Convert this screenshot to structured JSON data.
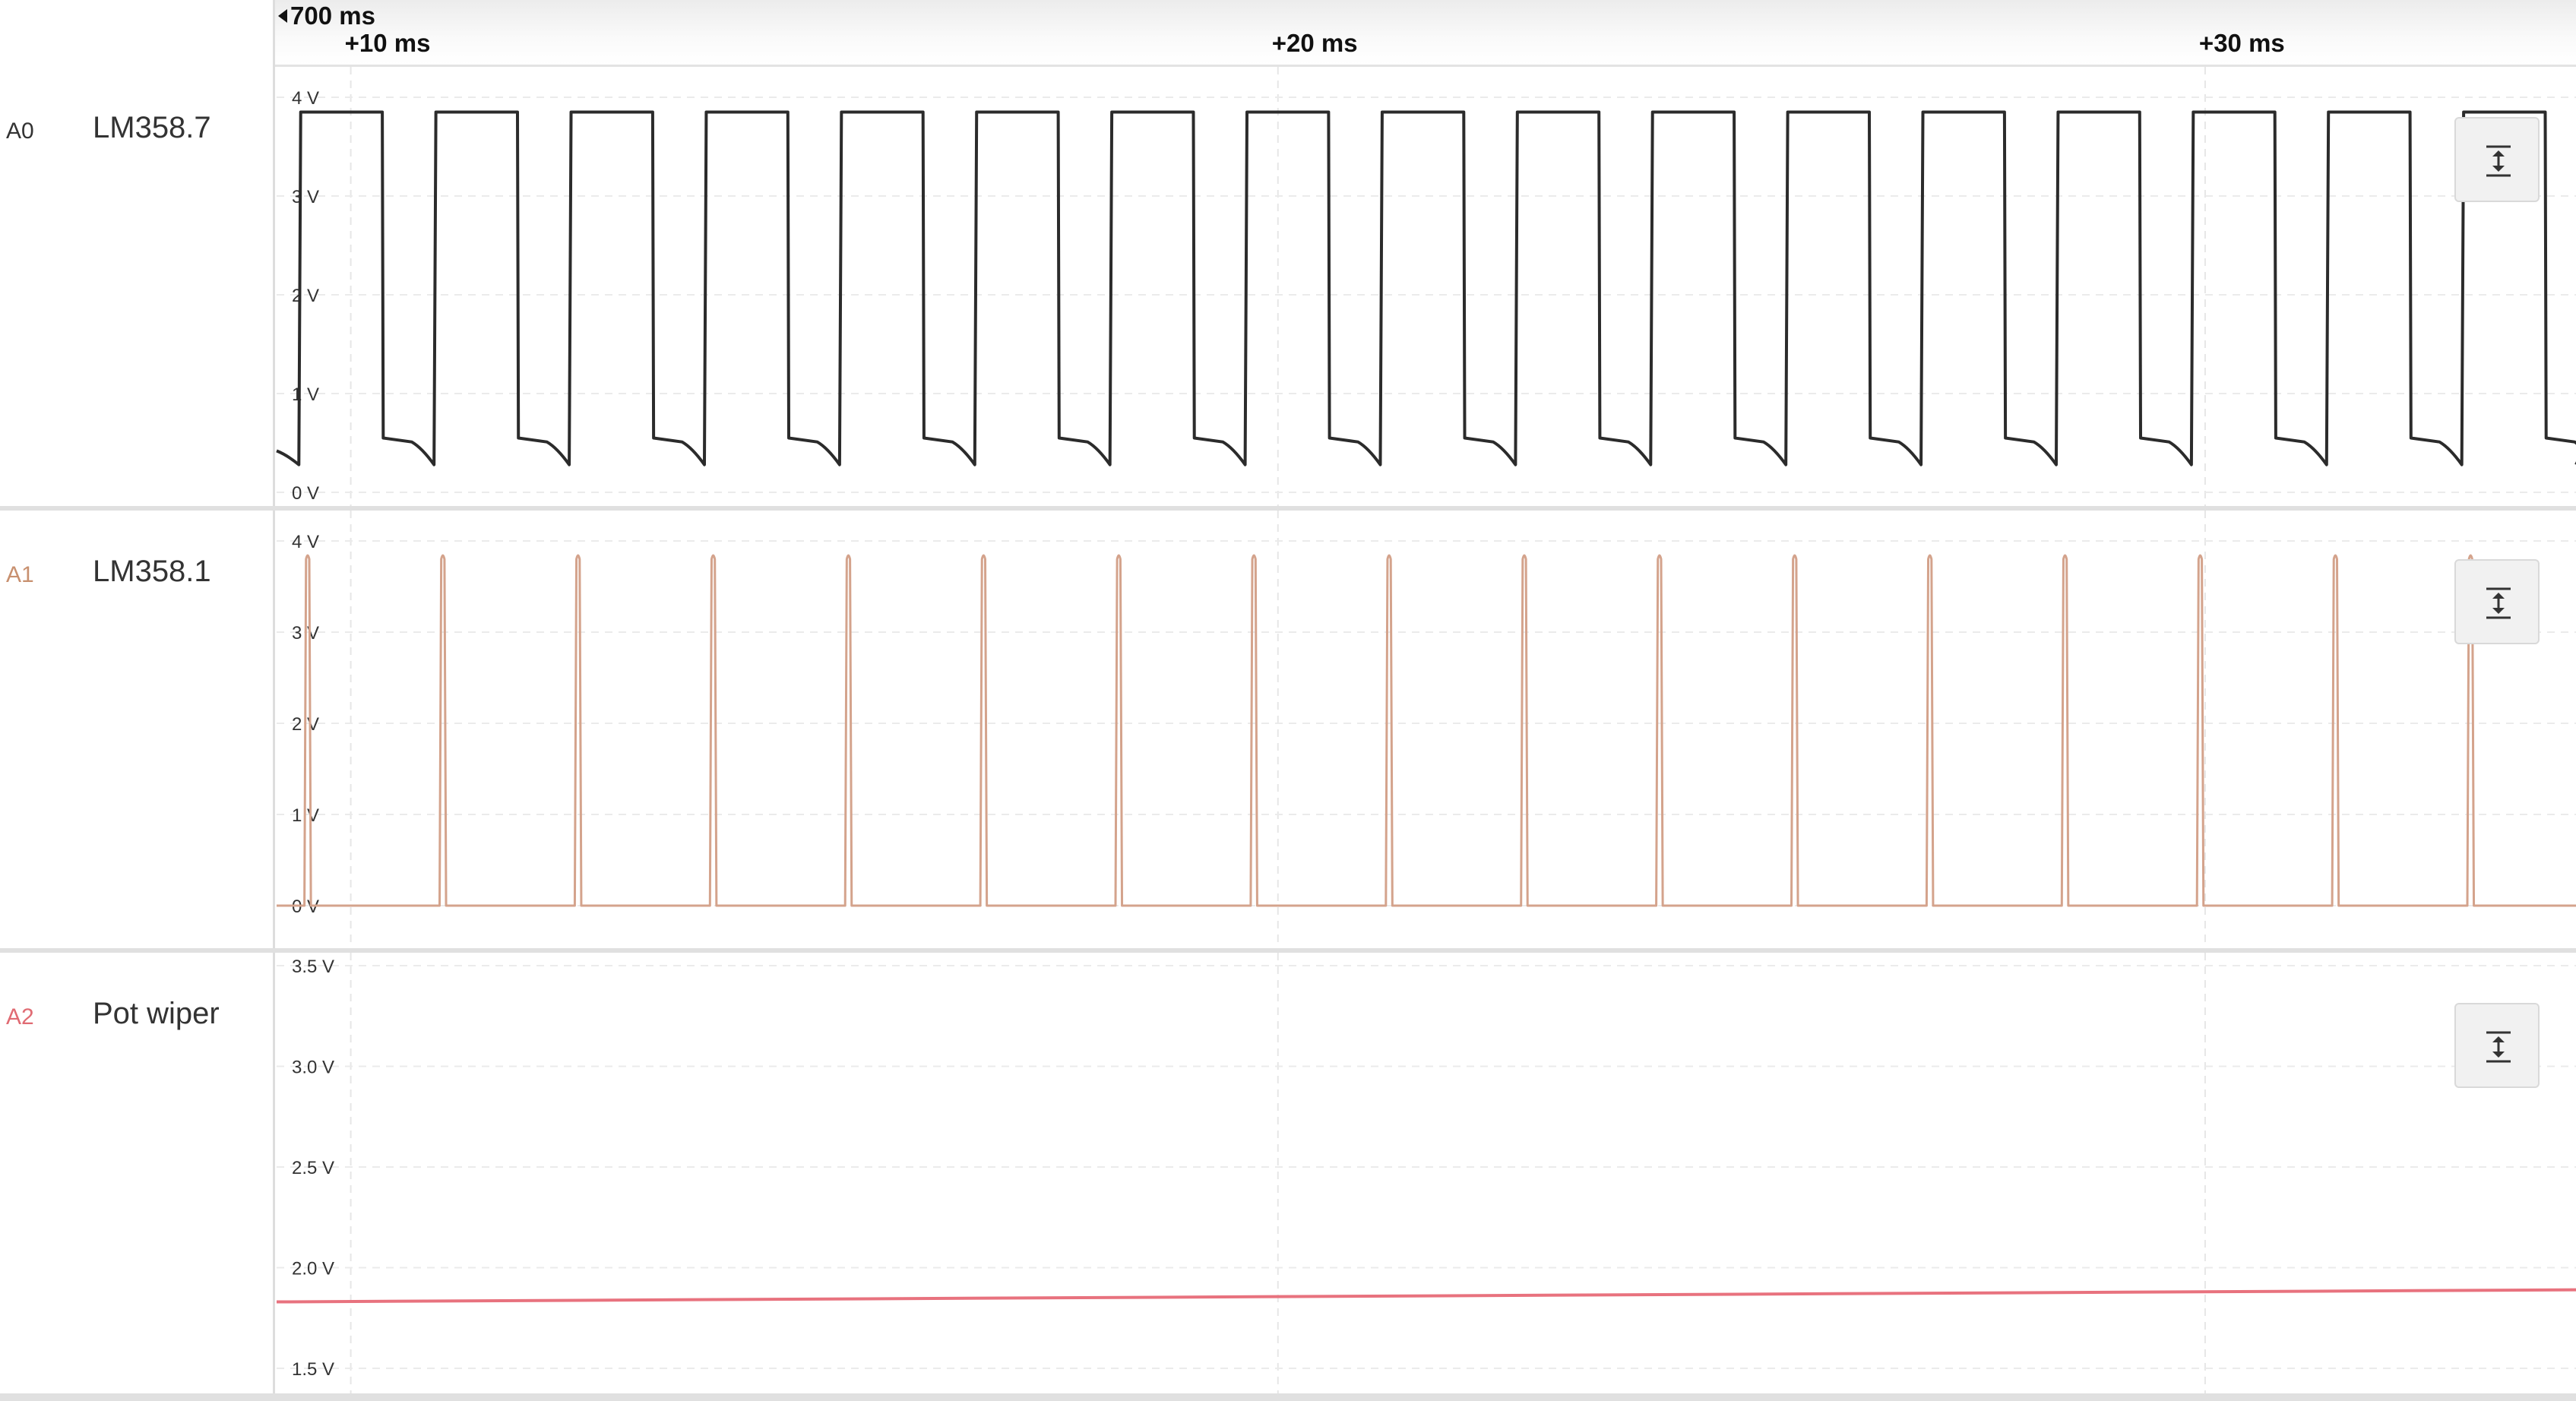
{
  "time_ruler": {
    "offset_label": "700 ms",
    "ticks": [
      {
        "label": "+10 ms",
        "t": 10
      },
      {
        "label": "+20 ms",
        "t": 20
      },
      {
        "label": "+30 ms",
        "t": 30
      }
    ]
  },
  "channels": [
    {
      "id": "A0",
      "name": "LM358.7",
      "color": "#2b2b2b",
      "id_color": "#333333",
      "y_ticks": [
        "4 V",
        "3 V",
        "2 V",
        "1 V",
        "0 V"
      ]
    },
    {
      "id": "A1",
      "name": "LM358.1",
      "color": "#d4a38c",
      "id_color": "#c8906f",
      "y_ticks": [
        "4 V",
        "3 V",
        "2 V",
        "1 V",
        "0 V"
      ]
    },
    {
      "id": "A2",
      "name": "Pot wiper",
      "color": "#e8727e",
      "id_color": "#e06b73",
      "y_ticks": [
        "3.5 V",
        "3.0 V",
        "2.5 V",
        "2.0 V",
        "1.5 V"
      ]
    }
  ],
  "chart_data": [
    {
      "type": "line",
      "title": "",
      "xlabel": "",
      "ylabel": "",
      "x_unit": "ms",
      "x_range": [
        9.2,
        34.0
      ],
      "ylim": [
        0,
        4
      ],
      "grid": true,
      "series": [
        {
          "name": "LM358.7",
          "waveform": "square",
          "high_v": 3.85,
          "low_start_v": 0.55,
          "low_end_v": 0.28,
          "period_ms": 1.458,
          "first_rise_ms": 9.46,
          "high_duration_ms": 0.88
        }
      ]
    },
    {
      "type": "line",
      "title": "",
      "xlabel": "",
      "ylabel": "",
      "x_unit": "ms",
      "x_range": [
        9.2,
        34.0
      ],
      "ylim": [
        0,
        4
      ],
      "grid": true,
      "series": [
        {
          "name": "LM358.1",
          "waveform": "pulse",
          "peak_v": 3.85,
          "baseline_v": 0.0,
          "period_ms": 1.458,
          "first_pulse_ms": 9.5,
          "pulse_width_ms": 0.07
        }
      ]
    },
    {
      "type": "line",
      "title": "",
      "xlabel": "",
      "ylabel": "",
      "x_unit": "ms",
      "x_range": [
        9.2,
        34.0
      ],
      "ylim": [
        1.5,
        3.5
      ],
      "grid": true,
      "series": [
        {
          "name": "Pot wiper",
          "x": [
            9.2,
            34.0
          ],
          "y": [
            1.83,
            1.89
          ]
        }
      ]
    }
  ]
}
